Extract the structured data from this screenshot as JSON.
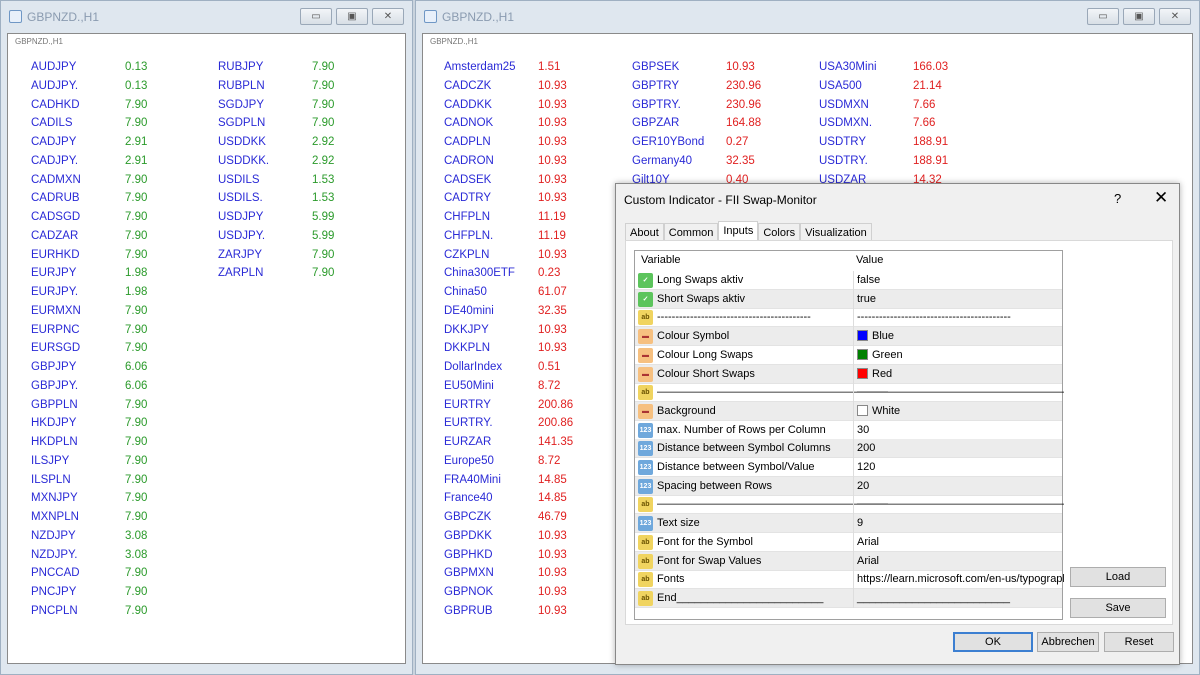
{
  "left_window": {
    "title": "GBPNZD.,H1",
    "chart_label": "GBPNZD.,H1",
    "columns": [
      [
        [
          "AUDJPY",
          "0.13"
        ],
        [
          "AUDJPY.",
          "0.13"
        ],
        [
          "CADHKD",
          "7.90"
        ],
        [
          "CADILS",
          "7.90"
        ],
        [
          "CADJPY",
          "2.91"
        ],
        [
          "CADJPY.",
          "2.91"
        ],
        [
          "CADMXN",
          "7.90"
        ],
        [
          "CADRUB",
          "7.90"
        ],
        [
          "CADSGD",
          "7.90"
        ],
        [
          "CADZAR",
          "7.90"
        ],
        [
          "EURHKD",
          "7.90"
        ],
        [
          "EURJPY",
          "1.98"
        ],
        [
          "EURJPY.",
          "1.98"
        ],
        [
          "EURMXN",
          "7.90"
        ],
        [
          "EURPNC",
          "7.90"
        ],
        [
          "EURSGD",
          "7.90"
        ],
        [
          "GBPJPY",
          "6.06"
        ],
        [
          "GBPJPY.",
          "6.06"
        ],
        [
          "GBPPLN",
          "7.90"
        ],
        [
          "HKDJPY",
          "7.90"
        ],
        [
          "HKDPLN",
          "7.90"
        ],
        [
          "ILSJPY",
          "7.90"
        ],
        [
          "ILSPLN",
          "7.90"
        ],
        [
          "MXNJPY",
          "7.90"
        ],
        [
          "MXNPLN",
          "7.90"
        ],
        [
          "NZDJPY",
          "3.08"
        ],
        [
          "NZDJPY.",
          "3.08"
        ],
        [
          "PNCCAD",
          "7.90"
        ],
        [
          "PNCJPY",
          "7.90"
        ],
        [
          "PNCPLN",
          "7.90"
        ]
      ],
      [
        [
          "RUBJPY",
          "7.90"
        ],
        [
          "RUBPLN",
          "7.90"
        ],
        [
          "SGDJPY",
          "7.90"
        ],
        [
          "SGDPLN",
          "7.90"
        ],
        [
          "USDDKK",
          "2.92"
        ],
        [
          "USDDKK.",
          "2.92"
        ],
        [
          "USDILS",
          "1.53"
        ],
        [
          "USDILS.",
          "1.53"
        ],
        [
          "USDJPY",
          "5.99"
        ],
        [
          "USDJPY.",
          "5.99"
        ],
        [
          "ZARJPY",
          "7.90"
        ],
        [
          "ZARPLN",
          "7.90"
        ]
      ]
    ]
  },
  "right_window": {
    "title": "GBPNZD.,H1",
    "chart_label": "GBPNZD.,H1",
    "columns": [
      [
        [
          "Amsterdam25",
          "1.51"
        ],
        [
          "CADCZK",
          "10.93"
        ],
        [
          "CADDKK",
          "10.93"
        ],
        [
          "CADNOK",
          "10.93"
        ],
        [
          "CADPLN",
          "10.93"
        ],
        [
          "CADRON",
          "10.93"
        ],
        [
          "CADSEK",
          "10.93"
        ],
        [
          "CADTRY",
          "10.93"
        ],
        [
          "CHFPLN",
          "11.19"
        ],
        [
          "CHFPLN.",
          "11.19"
        ],
        [
          "CZKPLN",
          "10.93"
        ],
        [
          "China300ETF",
          "0.23"
        ],
        [
          "China50",
          "61.07"
        ],
        [
          "DE40mini",
          "32.35"
        ],
        [
          "DKKJPY",
          "10.93"
        ],
        [
          "DKKPLN",
          "10.93"
        ],
        [
          "DollarIndex",
          "0.51"
        ],
        [
          "EU50Mini",
          "8.72"
        ],
        [
          "EURTRY",
          "200.86"
        ],
        [
          "EURTRY.",
          "200.86"
        ],
        [
          "EURZAR",
          "141.35"
        ],
        [
          "Europe50",
          "8.72"
        ],
        [
          "FRA40Mini",
          "14.85"
        ],
        [
          "France40",
          "14.85"
        ],
        [
          "GBPCZK",
          "46.79"
        ],
        [
          "GBPDKK",
          "10.93"
        ],
        [
          "GBPHKD",
          "10.93"
        ],
        [
          "GBPMXN",
          "10.93"
        ],
        [
          "GBPNOK",
          "10.93"
        ],
        [
          "GBPRUB",
          "10.93"
        ]
      ],
      [
        [
          "GBPSEK",
          "10.93"
        ],
        [
          "GBPTRY",
          "230.96"
        ],
        [
          "GBPTRY.",
          "230.96"
        ],
        [
          "GBPZAR",
          "164.88"
        ],
        [
          "GER10YBond",
          "0.27"
        ],
        [
          "Germany40",
          "32.35"
        ],
        [
          "Gilt10Y",
          "0.40"
        ]
      ],
      [
        [
          "USA30Mini",
          "166.03"
        ],
        [
          "USA500",
          "21.14"
        ],
        [
          "USDMXN",
          "7.66"
        ],
        [
          "USDMXN.",
          "7.66"
        ],
        [
          "USDTRY",
          "188.91"
        ],
        [
          "USDTRY.",
          "188.91"
        ],
        [
          "USDZAR",
          "14.32"
        ]
      ]
    ]
  },
  "colors": {
    "symbol": "#2a2ad6",
    "long": "#2a9a2a",
    "short": "#e02020"
  },
  "dialog": {
    "title": "Custom Indicator - FII Swap-Monitor",
    "help": "?",
    "close": "✕",
    "tabs": [
      "About",
      "Common",
      "Inputs",
      "Colors",
      "Visualization"
    ],
    "active_tab": "Inputs",
    "headers": {
      "variable": "Variable",
      "value": "Value"
    },
    "rows": [
      {
        "icon": "bool",
        "name": "Long Swaps aktiv",
        "value": "false"
      },
      {
        "icon": "bool",
        "name": "Short Swaps aktiv",
        "value": "true"
      },
      {
        "icon": "str",
        "name": "------------------------------------------",
        "value": "------------------------------------------"
      },
      {
        "icon": "clr",
        "name": "Colour Symbol",
        "value": "Blue",
        "swatch": "#0000ff"
      },
      {
        "icon": "clr",
        "name": "Colour Long Swaps",
        "value": "Green",
        "swatch": "#008000"
      },
      {
        "icon": "clr",
        "name": "Colour Short Swaps",
        "value": "Red",
        "swatch": "#ff0000"
      },
      {
        "icon": "str",
        "name": "—————————————————————",
        "value": "—————————————————————"
      },
      {
        "icon": "clr",
        "name": "Background",
        "value": "White",
        "swatch": "#ffffff"
      },
      {
        "icon": "int",
        "name": "max. Number of Rows per Column",
        "value": "30"
      },
      {
        "icon": "int",
        "name": "Distance between Symbol Columns",
        "value": "200"
      },
      {
        "icon": "int",
        "name": "Distance between Symbol/Value",
        "value": "120"
      },
      {
        "icon": "int",
        "name": "Spacing between Rows",
        "value": "20"
      },
      {
        "icon": "str",
        "name": "—————————————————————",
        "value": "—————————————————————"
      },
      {
        "icon": "int",
        "name": "Text size",
        "value": "9"
      },
      {
        "icon": "str",
        "name": "Font for the Symbol",
        "value": "Arial"
      },
      {
        "icon": "str",
        "name": "Font for Swap Values",
        "value": "Arial"
      },
      {
        "icon": "str",
        "name": "Fonts",
        "value": "https://learn.microsoft.com/en-us/typograph..."
      },
      {
        "icon": "str",
        "name": "End________________________",
        "value": "_________________________"
      }
    ],
    "buttons": {
      "load": "Load",
      "save": "Save",
      "ok": "OK",
      "cancel": "Abbrechen",
      "reset": "Reset"
    }
  }
}
